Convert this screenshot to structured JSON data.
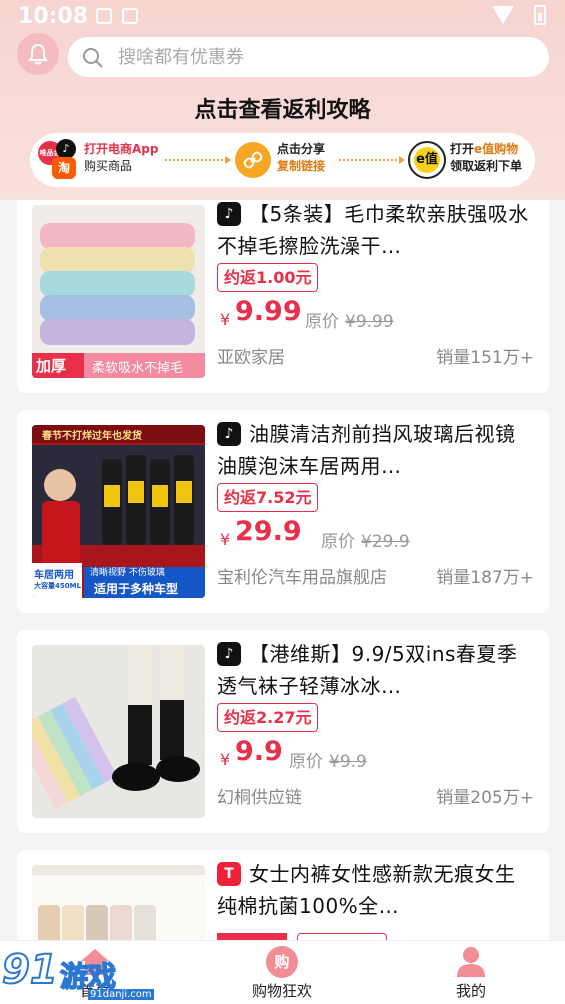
{
  "status_bar": {
    "time": "10:08"
  },
  "search": {
    "placeholder": "搜啥都有优惠券"
  },
  "guide": {
    "title": "点击查看返利攻略",
    "steps": [
      {
        "line1": "打开电商App",
        "line2": "购买商品"
      },
      {
        "line1": "点击分享",
        "line2": "复制链接"
      },
      {
        "line1_prefix": "打开",
        "line1_brand": "e值购物",
        "line2": "领取返利下单"
      }
    ],
    "app_badges": [
      "唯品会",
      "♪",
      "淘"
    ],
    "brand_badge": "e值"
  },
  "products": [
    {
      "platform": "douyin",
      "platform_glyph": "♪",
      "title": "【5条装】毛巾柔软亲肤强吸水不掉毛擦脸洗澡干…",
      "rebate": "约返1.00元",
      "price_symbol": "¥",
      "price": "9.99",
      "orig_label": "原价",
      "orig_price": "¥9.99",
      "shop": "亚欧家居",
      "sales": "销量151万+",
      "thumb_tags": [
        "加厚",
        "柔软吸水不掉毛"
      ]
    },
    {
      "platform": "douyin",
      "platform_glyph": "♪",
      "title": "油膜清洁剂前挡风玻璃后视镜油膜泡沫车居两用…",
      "rebate": "约返7.52元",
      "price_symbol": "¥",
      "price": "29.9",
      "orig_label": "原价",
      "orig_price": "¥29.9",
      "shop": "宝利伦汽车用品旗舰店",
      "sales": "销量187万+",
      "thumb_tags": [
        "春节不打烊过年也发货",
        "车居两用",
        "大容量450ML",
        "清晰视野 不伤玻璃",
        "适用于多种车型"
      ]
    },
    {
      "platform": "douyin",
      "platform_glyph": "♪",
      "title": "【港维斯】9.9/5双ins春夏季透气袜子轻薄冰冰…",
      "rebate": "约返2.27元",
      "price_symbol": "¥",
      "price": "9.9",
      "orig_label": "原价",
      "orig_price": "¥9.9",
      "shop": "幻桐供应链",
      "sales": "销量205万+",
      "thumb_tags": []
    },
    {
      "platform": "tmall",
      "platform_glyph": "T",
      "title": "女士内裤女性感新款无痕女生纯棉抗菌100%全…",
      "rebate": "",
      "price_symbol": "",
      "price": "",
      "orig_label": "",
      "orig_price": "",
      "shop": "",
      "sales": "",
      "thumb_tags": []
    }
  ],
  "tabs": [
    {
      "label": "首页",
      "icon": "home-icon"
    },
    {
      "label": "购物狂欢",
      "icon": "shopping-icon",
      "badge": "购"
    },
    {
      "label": "我的",
      "icon": "profile-icon"
    }
  ],
  "watermark": {
    "logo_num": "91",
    "logo_text": "游戏",
    "url": "91danji.com"
  },
  "colors": {
    "accent": "#e8304a",
    "header_bg": "#f6d4d0",
    "share": "#f5a623"
  }
}
